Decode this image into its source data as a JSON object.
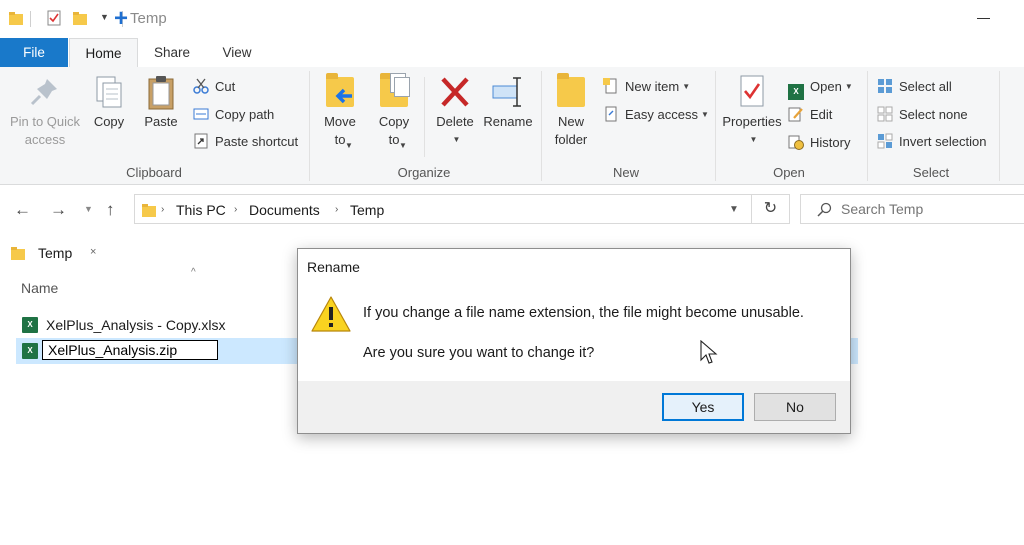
{
  "window": {
    "title": "Temp"
  },
  "ribbon_tabs": {
    "file": "File",
    "home": "Home",
    "share": "Share",
    "view": "View"
  },
  "ribbon": {
    "clipboard": {
      "label": "Clipboard",
      "pin": "Pin to Quick access",
      "copy": "Copy",
      "paste": "Paste",
      "cut": "Cut",
      "copy_path": "Copy path",
      "paste_shortcut": "Paste shortcut"
    },
    "organize": {
      "label": "Organize",
      "move_to": "Move to",
      "copy_to": "Copy to",
      "delete": "Delete",
      "rename": "Rename"
    },
    "new": {
      "label": "New",
      "new_folder": "New folder",
      "new_item": "New item",
      "easy_access": "Easy access"
    },
    "open": {
      "label": "Open",
      "properties": "Properties",
      "open": "Open",
      "edit": "Edit",
      "history": "History"
    },
    "select": {
      "label": "Select",
      "select_all": "Select all",
      "select_none": "Select none",
      "invert_selection": "Invert selection"
    }
  },
  "address": {
    "crumbs": [
      "This PC",
      "Documents",
      "Temp"
    ],
    "search_placeholder": "Search Temp"
  },
  "folder_tab": {
    "label": "Temp",
    "close": "×",
    "add": "+"
  },
  "file_list": {
    "column_name": "Name",
    "files": [
      {
        "name": "XelPlus_Analysis - Copy.xlsx"
      },
      {
        "name": "XelPlus_Analysis.zip"
      }
    ]
  },
  "dialog": {
    "title": "Rename",
    "message_line1": "If you change a file name extension, the file might become unusable.",
    "message_line2": "Are you sure you want to change it?",
    "yes": "Yes",
    "no": "No"
  },
  "colors": {
    "accent": "#1979ca",
    "selection": "#cce8ff",
    "folder": "#f6c94a",
    "delete_red": "#c62828",
    "warning": "#f9d320"
  }
}
